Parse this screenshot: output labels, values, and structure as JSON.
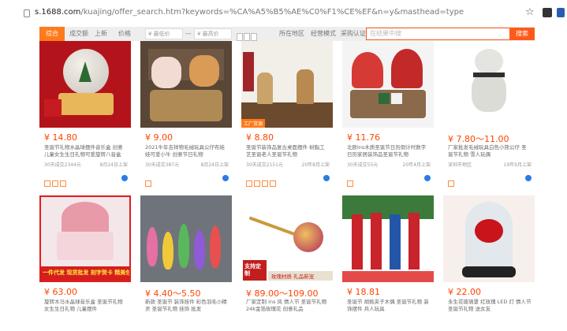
{
  "browser": {
    "url_host": "s.1688.com",
    "url_path": "/kuajing/offer_search.htm?keywords=%CA%A5%B5%AE%C0%F1%CE%EF&n=y&masthead=type",
    "star_icon": "star-icon"
  },
  "toolbar": {
    "sort_label": "综合",
    "buttons": [
      "成交额",
      "上新",
      "价格"
    ],
    "price_min_placeholder": "¥ 最低价",
    "price_max_placeholder": "¥ 最高价",
    "dash": "—",
    "filters": [
      "所在地区",
      "经营模式",
      "采购认证"
    ],
    "search_placeholder": "在结果中搜",
    "search_button": "搜索",
    "accent": "#ff5a1a"
  },
  "products": [
    {
      "price": "¥ 14.80",
      "title": "圣诞节礼物水晶球摆件音乐盒 创意儿童女生生日礼物可爱旋转八音盒",
      "sales": "30天成交2344元",
      "date": "8月24日上架"
    },
    {
      "price": "¥ 9.00",
      "title": "2021牛年吉祥物毛绒玩具公仔布娃娃可爱小牛 创意节日礼物",
      "sales": "30天成交387元",
      "date": "8月24日上架"
    },
    {
      "price": "¥ 8.80",
      "title": "圣诞节装饰品复古桌面摆件 树脂工艺圣诞老人圣诞节礼物",
      "sales": "30天成交2151元",
      "date": "20年8月上架",
      "badge": "工厂货源"
    },
    {
      "price": "¥ 11.76",
      "title": "北欧ins木质圣诞节日历倒计时数字日历家居装饰品圣诞节礼物",
      "sales": "30天成交55元",
      "date": "20年4月上架"
    },
    {
      "price": "¥ 7.80～11.00",
      "title": "厂家批发毛绒玩具白色小熊公仔 圣诞节礼物 雪人玩偶",
      "sales": "深圳市地区",
      "date": "19年9月上架"
    },
    {
      "price": "¥ 63.00",
      "title": "旋转木马水晶球音乐盒 圣诞节礼物 女生生日礼物 儿童摆件",
      "sales": "",
      "date": "",
      "banner": "一件代发 现货批发 刻字贺卡 精美包装"
    },
    {
      "price": "¥ 4.40～5.50",
      "title": "新款 圣诞节 装饰挂件 彩色羽毛小精灵 圣诞节礼物 挂饰 批发",
      "sales": "",
      "date": ""
    },
    {
      "price": "¥ 89.00～109.00",
      "title": "厂家定制 ins 风 情人节 圣诞节礼物 24k金箔玫瑰花 创意礼品",
      "sales": "",
      "date": "",
      "banner": "支持定制",
      "banner2": "玫瑰材质 礼品新宠"
    },
    {
      "price": "¥ 18.81",
      "title": "圣诞节 胡桃夹子木偶 圣诞节礼物 装饰摆件 兵人玩具",
      "sales": "",
      "date": ""
    },
    {
      "price": "¥ 22.00",
      "title": "永生花玻璃罩 红玫瑰 LED 灯 情人节 圣诞节礼物 送女友",
      "sales": "",
      "date": ""
    }
  ],
  "colors": {
    "price": "#ff4400",
    "orange": "#ff7a1a",
    "wangwang": "#2c7be5"
  }
}
